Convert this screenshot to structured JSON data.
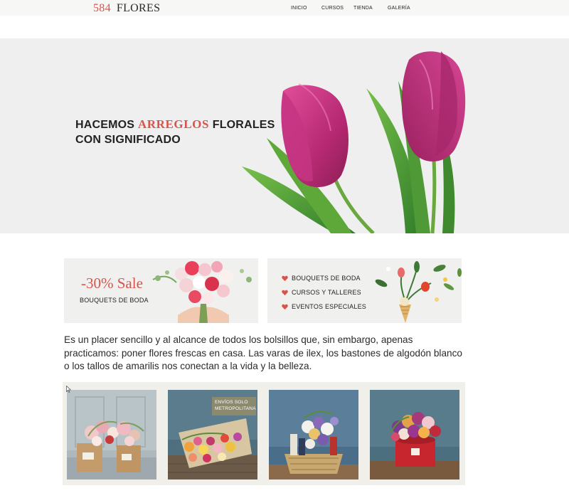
{
  "brand": {
    "number": "584",
    "name": "FLORES"
  },
  "nav": {
    "items": [
      {
        "label": "INICIO"
      },
      {
        "label": "CURSOS"
      },
      {
        "label": "TIENDA"
      },
      {
        "label": "GALERÍA"
      }
    ]
  },
  "hero": {
    "line1_start": "HACEMOS",
    "line1_accent": "ARREGLOS",
    "line1_end": "FLORALES",
    "line2": "CON SIGNIFICADO",
    "image": "pink-tulips-illustration"
  },
  "promos": {
    "sale": {
      "title": "-30% Sale",
      "subtitle": "BOUQUETS DE BODA",
      "image": "bouquet-in-hands"
    },
    "services": {
      "items": [
        {
          "label": "BOUQUETS DE BODA",
          "icon": "heart-icon"
        },
        {
          "label": "CURSOS Y TALLERES",
          "icon": "heart-icon"
        },
        {
          "label": "EVENTOS ESPECIALES",
          "icon": "heart-icon"
        }
      ],
      "image": "flowers-in-cone"
    }
  },
  "intro": {
    "text": "Es un placer sencillo y al alcance de todos los bolsillos que, sin embargo, apenas practicamos: poner flores frescas en casa. Las varas de ilex, los bastones de algodón blanco o los tallos de amarilis nos conectan a la vida y la belleza."
  },
  "gallery": {
    "items": [
      {
        "image": "gift-bag-arrangement"
      },
      {
        "image": "wrapped-bouquet",
        "badge": "ENVÍOS SOLO METROPOLITANA"
      },
      {
        "image": "flower-basket"
      },
      {
        "image": "hatbox-roses"
      }
    ]
  },
  "colors": {
    "accent": "#d9534a",
    "hero_bg": "#efefef",
    "gallery_bg": "#f1efe9",
    "badge": "#8c8a6e"
  }
}
